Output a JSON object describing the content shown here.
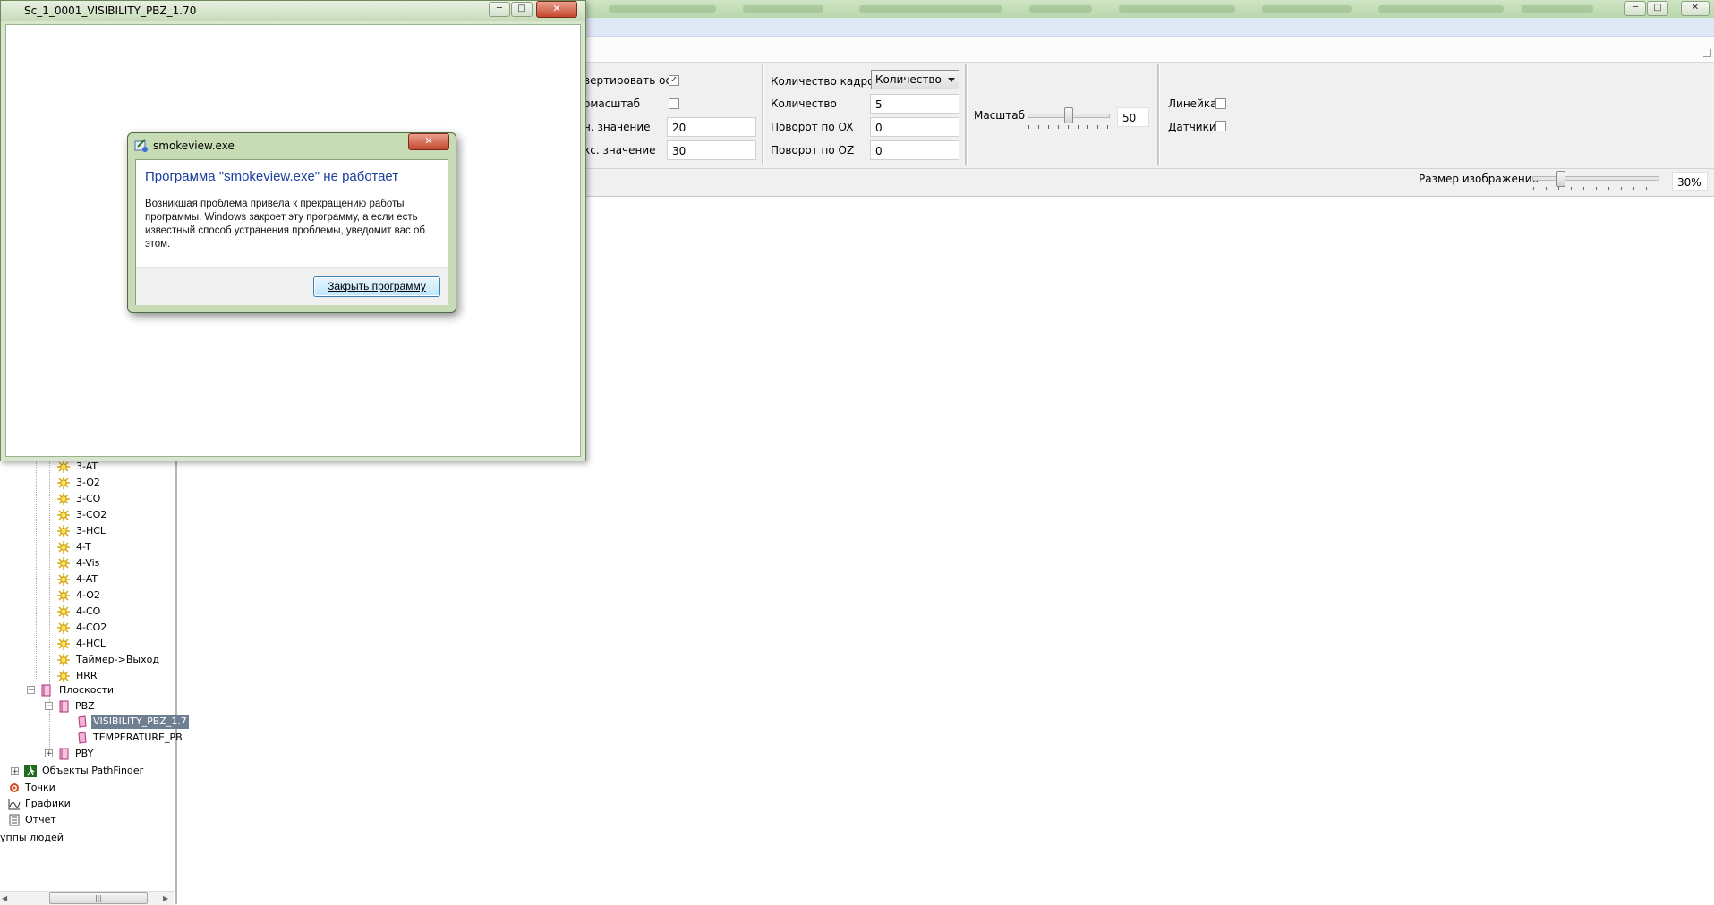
{
  "child_window": {
    "title": "Sc_1_0001_VISIBILITY_PBZ_1.70",
    "controls": {
      "minimize": "─",
      "maximize": "□",
      "close": "✕"
    }
  },
  "main_window": {
    "controls": {
      "minimize": "─",
      "maximize": "□",
      "close": "✕"
    }
  },
  "dialog": {
    "title": "smokeview.exe",
    "close_glyph": "✕",
    "heading": "Программа \"smokeview.exe\" не работает",
    "message": "Возникшая проблема привела к прекращению работы программы. Windows закроет эту программу, а если есть известный способ устранения проблемы, уведомит вас об этом.",
    "button_label": "Закрыть программу"
  },
  "toolbar": {
    "invert_axis_label": "вертировать ось",
    "invert_axis_checked": true,
    "autoscale_label": "омасштаб",
    "autoscale_checked": false,
    "min_value_label": "н. значение",
    "min_value": "20",
    "max_value_label": "кс. значение",
    "max_value": "30",
    "frames_count_label": "Количество кадров",
    "frames_mode": "Количество",
    "count_label": "Количество",
    "count_value": "5",
    "rot_ox_label": "Поворот по OX",
    "rot_ox_value": "0",
    "rot_oz_label": "Поворот по OZ",
    "rot_oz_value": "0",
    "scale_label": "Масштаб",
    "scale_value": "50",
    "ruler_label": "Линейка",
    "ruler_checked": false,
    "sensors_label": "Датчики",
    "sensors_checked": false,
    "image_size_label": "Размер изображения",
    "image_size_value": "30%"
  },
  "tree": {
    "items": [
      {
        "label": "3-AT"
      },
      {
        "label": "3-O2"
      },
      {
        "label": "3-CO"
      },
      {
        "label": "3-CO2"
      },
      {
        "label": "3-HCL"
      },
      {
        "label": "4-T"
      },
      {
        "label": "4-Vis"
      },
      {
        "label": "4-AT"
      },
      {
        "label": "4-O2"
      },
      {
        "label": "4-CO"
      },
      {
        "label": "4-CO2"
      },
      {
        "label": "4-HCL"
      },
      {
        "label": "Таймер->Выход"
      },
      {
        "label": "HRR"
      }
    ],
    "planes_label": "Плоскости",
    "pbz_label": "PBZ",
    "visibility_label": "VISIBILITY_PBZ_1.7",
    "temperature_label": "TEMPERATURE_PB",
    "pby_label": "PBY",
    "pathfinder_label": "Объекты PathFinder",
    "points_label": "Точки",
    "graphs_label": "Графики",
    "report_label": "Отчет",
    "groups_label": "уппы людей",
    "scroll_thumb": "|||",
    "expander_minus": "−",
    "expander_plus": "+"
  },
  "colors": {
    "accent_heading": "#1a3e9e",
    "sun": "#e0b400",
    "folder": "#cc3b8a",
    "selection": "#6f7f92"
  }
}
